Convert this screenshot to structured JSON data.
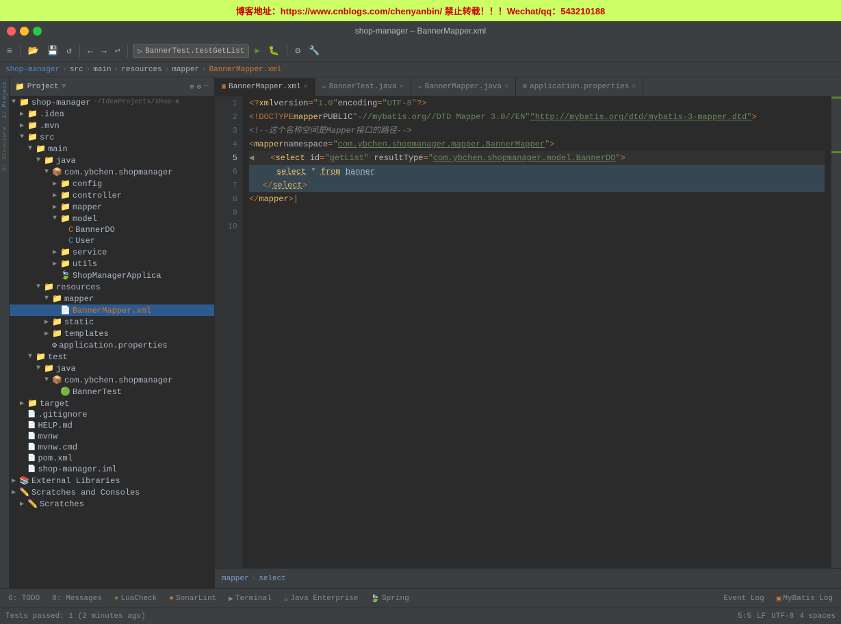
{
  "banner": {
    "text": "博客地址：https://www.cnblogs.com/chenyanbin/          禁止转载！！！Wechat/qq：543210188"
  },
  "titlebar": {
    "title": "shop-manager – BannerMapper.xml"
  },
  "breadcrumb": {
    "items": [
      "shop-manager",
      "src",
      "main",
      "resources",
      "mapper",
      "BannerMapper.xml"
    ]
  },
  "tabs": [
    {
      "label": "BannerMapper.xml",
      "icon": "xml",
      "active": true
    },
    {
      "label": "BannerTest.java",
      "icon": "java",
      "active": false
    },
    {
      "label": "BannerMapper.java",
      "icon": "java",
      "active": false
    },
    {
      "label": "application.properties",
      "icon": "props",
      "active": false
    }
  ],
  "tree": {
    "header": "Project",
    "items": [
      {
        "indent": 0,
        "arrow": "▼",
        "icon": "📁",
        "label": "shop-manager",
        "extra": "~/IdeaProjects/shop-m",
        "type": "root"
      },
      {
        "indent": 1,
        "arrow": "▶",
        "icon": "📁",
        "label": ".idea",
        "type": "folder"
      },
      {
        "indent": 1,
        "arrow": "▶",
        "icon": "📁",
        "label": ".mvn",
        "type": "folder"
      },
      {
        "indent": 1,
        "arrow": "▼",
        "icon": "📁",
        "label": "src",
        "type": "folder"
      },
      {
        "indent": 2,
        "arrow": "▼",
        "icon": "📁",
        "label": "main",
        "type": "folder"
      },
      {
        "indent": 3,
        "arrow": "▼",
        "icon": "📁",
        "label": "java",
        "type": "folder"
      },
      {
        "indent": 4,
        "arrow": "▼",
        "icon": "📦",
        "label": "com.ybchen.shopmanager",
        "type": "package"
      },
      {
        "indent": 5,
        "arrow": "▶",
        "icon": "📁",
        "label": "config",
        "type": "folder"
      },
      {
        "indent": 5,
        "arrow": "▶",
        "icon": "📁",
        "label": "controller",
        "type": "folder"
      },
      {
        "indent": 5,
        "arrow": "▶",
        "icon": "📁",
        "label": "mapper",
        "type": "folder"
      },
      {
        "indent": 5,
        "arrow": "▼",
        "icon": "📁",
        "label": "model",
        "type": "folder"
      },
      {
        "indent": 6,
        "arrow": "",
        "icon": "🟠",
        "label": "BannerDO",
        "type": "java"
      },
      {
        "indent": 6,
        "arrow": "",
        "icon": "🟠",
        "label": "User",
        "type": "java"
      },
      {
        "indent": 5,
        "arrow": "▶",
        "icon": "📁",
        "label": "service",
        "type": "folder"
      },
      {
        "indent": 5,
        "arrow": "▶",
        "icon": "📁",
        "label": "utils",
        "type": "folder"
      },
      {
        "indent": 5,
        "arrow": "",
        "icon": "🟢",
        "label": "ShopManagerApplica",
        "type": "java"
      },
      {
        "indent": 3,
        "arrow": "▼",
        "icon": "📁",
        "label": "resources",
        "type": "folder"
      },
      {
        "indent": 4,
        "arrow": "▼",
        "icon": "📁",
        "label": "mapper",
        "type": "folder"
      },
      {
        "indent": 5,
        "arrow": "",
        "icon": "📄",
        "label": "BannerMapper.xml",
        "type": "xml",
        "selected": true
      },
      {
        "indent": 4,
        "arrow": "▶",
        "icon": "📁",
        "label": "static",
        "type": "folder"
      },
      {
        "indent": 4,
        "arrow": "▶",
        "icon": "📁",
        "label": "templates",
        "type": "folder"
      },
      {
        "indent": 4,
        "arrow": "",
        "icon": "⚙️",
        "label": "application.properties",
        "type": "props"
      },
      {
        "indent": 2,
        "arrow": "▼",
        "icon": "📁",
        "label": "test",
        "type": "folder"
      },
      {
        "indent": 3,
        "arrow": "▼",
        "icon": "📁",
        "label": "java",
        "type": "folder"
      },
      {
        "indent": 4,
        "arrow": "▼",
        "icon": "📦",
        "label": "com.ybchen.shopmanager",
        "type": "package"
      },
      {
        "indent": 5,
        "arrow": "",
        "icon": "🟢",
        "label": "BannerTest",
        "type": "java"
      },
      {
        "indent": 1,
        "arrow": "▶",
        "icon": "📁",
        "label": "target",
        "type": "folder"
      },
      {
        "indent": 1,
        "arrow": "",
        "icon": "📄",
        "label": ".gitignore",
        "type": "file"
      },
      {
        "indent": 1,
        "arrow": "",
        "icon": "📄",
        "label": "HELP.md",
        "type": "file"
      },
      {
        "indent": 1,
        "arrow": "",
        "icon": "📄",
        "label": "mvnw",
        "type": "file"
      },
      {
        "indent": 1,
        "arrow": "",
        "icon": "📄",
        "label": "mvnw.cmd",
        "type": "file"
      },
      {
        "indent": 1,
        "arrow": "",
        "icon": "📄",
        "label": "pom.xml",
        "type": "file"
      },
      {
        "indent": 1,
        "arrow": "",
        "icon": "📄",
        "label": "shop-manager.iml",
        "type": "file"
      },
      {
        "indent": 0,
        "arrow": "▶",
        "icon": "📚",
        "label": "External Libraries",
        "type": "folder"
      },
      {
        "indent": 0,
        "arrow": "▶",
        "icon": "✏️",
        "label": "Scratches and Consoles",
        "type": "folder"
      },
      {
        "indent": 0,
        "arrow": "▶",
        "icon": "✏️",
        "label": "Scratches",
        "type": "folder"
      }
    ]
  },
  "code": {
    "lines": [
      {
        "num": 1,
        "content": "<?xml version=\"1.0\" encoding=\"UTF-8\"?>"
      },
      {
        "num": 2,
        "content": "<!DOCTYPE mapper PUBLIC \"-//mybatis.org//DTD Mapper 3.0//EN\" \"http://mybatis.org/dtd/mybatis-3-mapper.dtd\">"
      },
      {
        "num": 3,
        "content": "<!--这个名称空间是Mapper接口的路径-->"
      },
      {
        "num": 4,
        "content": "<mapper namespace=\"com.ybchen.shopmanager.mapper.BannerMapper\">"
      },
      {
        "num": 5,
        "content": "    <select id=\"getList\" resultType=\"com.ybchen.shopmanager.model.BannerDO\">"
      },
      {
        "num": 6,
        "content": "        select * from banner"
      },
      {
        "num": 7,
        "content": "    </select>"
      },
      {
        "num": 8,
        "content": "</mapper>"
      },
      {
        "num": 9,
        "content": ""
      },
      {
        "num": 10,
        "content": ""
      }
    ]
  },
  "bottom_breadcrumb": {
    "items": [
      "mapper",
      "select"
    ]
  },
  "status": {
    "position": "5:5",
    "lf": "LF",
    "encoding": "UTF-8",
    "spaces": "4 spaces"
  },
  "bottom_tabs": [
    {
      "label": "6: TODO",
      "badge": ""
    },
    {
      "label": "0: Messages",
      "badge": "0"
    },
    {
      "label": "LuaCheck",
      "badge": ""
    },
    {
      "label": "SonarLint",
      "badge": ""
    },
    {
      "label": "Terminal",
      "badge": ""
    },
    {
      "label": "Java Enterprise",
      "badge": ""
    },
    {
      "label": "Spring",
      "badge": ""
    }
  ],
  "status_right": {
    "event_log": "Event Log",
    "mybatis_log": "MyBatis Log"
  },
  "run_config": {
    "label": "BannerTest.testGetList"
  },
  "footer": {
    "test_status": "Tests passed: 1 (2 minutes ago)"
  }
}
